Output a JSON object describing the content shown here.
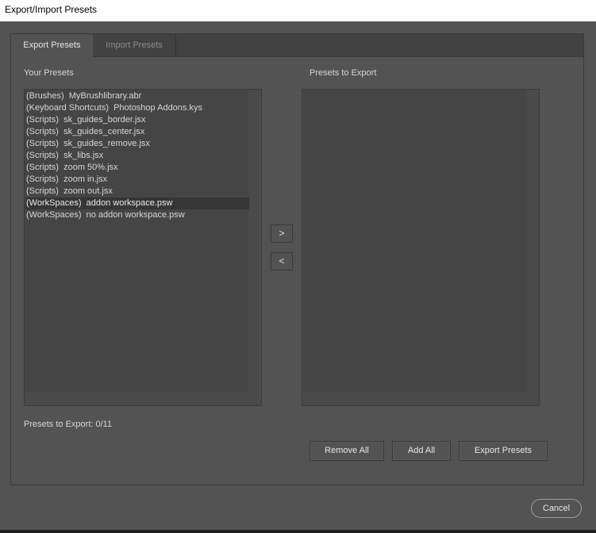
{
  "window": {
    "title": "Export/Import Presets"
  },
  "tabs": [
    {
      "label": "Export Presets",
      "active": true
    },
    {
      "label": "Import Presets",
      "active": false
    }
  ],
  "your_presets": {
    "label": "Your Presets",
    "items": [
      {
        "category": "(Brushes)",
        "name": "MyBrushlibrary.abr",
        "selected": false
      },
      {
        "category": "(Keyboard Shortcuts)",
        "name": "Photoshop Addons.kys",
        "selected": false
      },
      {
        "category": "(Scripts)",
        "name": "sk_guides_border.jsx",
        "selected": false
      },
      {
        "category": "(Scripts)",
        "name": "sk_guides_center.jsx",
        "selected": false
      },
      {
        "category": "(Scripts)",
        "name": "sk_guides_remove.jsx",
        "selected": false
      },
      {
        "category": "(Scripts)",
        "name": "sk_libs.jsx",
        "selected": false
      },
      {
        "category": "(Scripts)",
        "name": "zoom 50%.jsx",
        "selected": false
      },
      {
        "category": "(Scripts)",
        "name": "zoom in.jsx",
        "selected": false
      },
      {
        "category": "(Scripts)",
        "name": "zoom out.jsx",
        "selected": false
      },
      {
        "category": "(WorkSpaces)",
        "name": "addon workspace.psw",
        "selected": true
      },
      {
        "category": "(WorkSpaces)",
        "name": "no addon workspace.psw",
        "selected": false
      }
    ]
  },
  "presets_to_export": {
    "label": "Presets to Export",
    "items": []
  },
  "transfer": {
    "add_label": ">",
    "remove_label": "<"
  },
  "status": {
    "count_text": "Presets to Export: 0/11"
  },
  "actions": {
    "remove_all": "Remove All",
    "add_all": "Add All",
    "export_presets": "Export Presets",
    "cancel": "Cancel"
  },
  "colors": {
    "background": "#535353",
    "list_background": "#454545",
    "selected_row": "#363636",
    "text": "#d6d6d6"
  }
}
